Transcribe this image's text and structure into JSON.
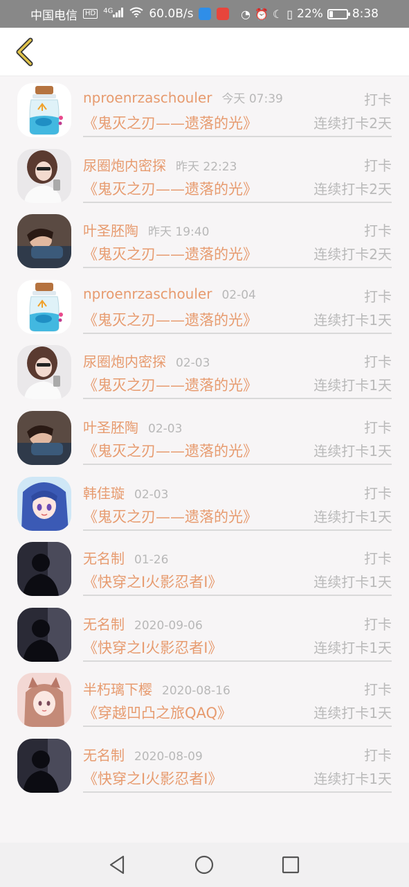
{
  "status_bar": {
    "carrier": "中国电信",
    "hd_badge": "HD",
    "network_type": "4G",
    "speed": "60.0B/s",
    "battery": "22%",
    "battery_level": 0.22,
    "time": "8:38"
  },
  "colors": {
    "accent": "#e79b6f",
    "muted": "#b9b9b9",
    "back_arrow": "#e0c34a"
  },
  "records": [
    {
      "user": "nproenrzaschouler",
      "time": "今天 07:39",
      "action": "打卡",
      "book": "《鬼灭之刃——遗落的光》",
      "streak": "连续打卡2天",
      "avatar": "jar-avatar"
    },
    {
      "user": "尿圈炮内密探",
      "time": "昨天 22:23",
      "action": "打卡",
      "book": "《鬼灭之刃——遗落的光》",
      "streak": "连续打卡2天",
      "avatar": "girl-avatar"
    },
    {
      "user": "叶圣胚陶",
      "time": "昨天 19:40",
      "action": "打卡",
      "book": "《鬼灭之刃——遗落的光》",
      "streak": "连续打卡2天",
      "avatar": "sleeping-avatar"
    },
    {
      "user": "nproenrzaschouler",
      "time": "02-04",
      "action": "打卡",
      "book": "《鬼灭之刃——遗落的光》",
      "streak": "连续打卡1天",
      "avatar": "jar-avatar"
    },
    {
      "user": "尿圈炮内密探",
      "time": "02-03",
      "action": "打卡",
      "book": "《鬼灭之刃——遗落的光》",
      "streak": "连续打卡1天",
      "avatar": "girl-avatar"
    },
    {
      "user": "叶圣胚陶",
      "time": "02-03",
      "action": "打卡",
      "book": "《鬼灭之刃——遗落的光》",
      "streak": "连续打卡1天",
      "avatar": "sleeping-avatar"
    },
    {
      "user": "韩佳璇",
      "time": "02-03",
      "action": "打卡",
      "book": "《鬼灭之刃——遗落的光》",
      "streak": "连续打卡1天",
      "avatar": "anime-avatar"
    },
    {
      "user": "无名制",
      "time": "01-26",
      "action": "打卡",
      "book": "《快穿之I火影忍者I》",
      "streak": "连续打卡1天",
      "avatar": "silhouette-avatar"
    },
    {
      "user": "无名制",
      "time": "2020-09-06",
      "action": "打卡",
      "book": "《快穿之I火影忍者I》",
      "streak": "连续打卡1天",
      "avatar": "silhouette-avatar"
    },
    {
      "user": "半朽璃下樱",
      "time": "2020-08-16",
      "action": "打卡",
      "book": "《穿越凹凸之旅QAQ》",
      "streak": "连续打卡1天",
      "avatar": "fox-girl-avatar"
    },
    {
      "user": "无名制",
      "time": "2020-08-09",
      "action": "打卡",
      "book": "《快穿之I火影忍者I》",
      "streak": "连续打卡1天",
      "avatar": "silhouette-avatar"
    }
  ]
}
